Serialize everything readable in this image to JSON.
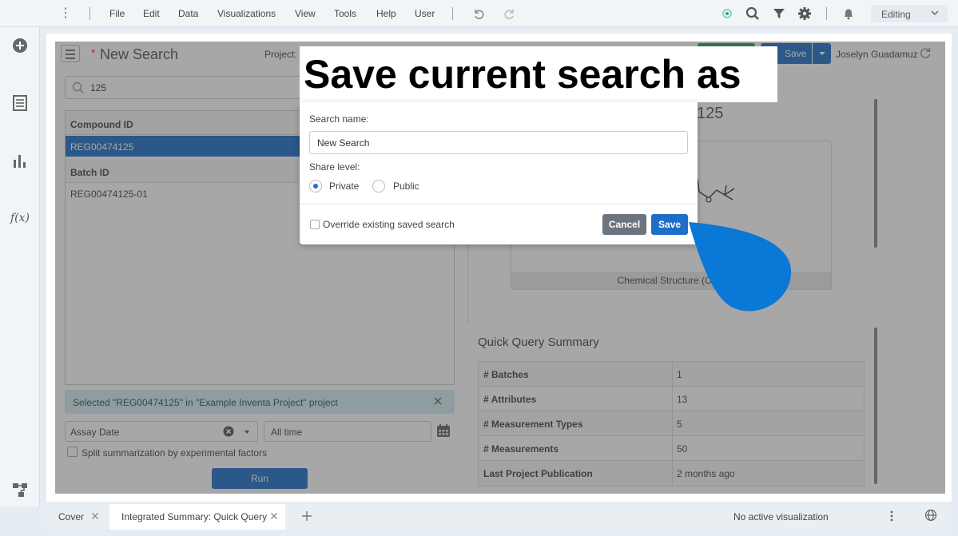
{
  "menubar": {
    "items": [
      "File",
      "Edit",
      "Data",
      "Visualizations",
      "View",
      "Tools",
      "Help",
      "User"
    ],
    "mode": "Editing"
  },
  "rail": {
    "icons": [
      "add-circle-icon",
      "data-table-icon",
      "bar-chart-icon",
      "function-icon",
      "workflow-icon"
    ],
    "fx_label": "f(x)"
  },
  "search_panel": {
    "title": "New Search",
    "required_mark": "*",
    "project_label": "Project:",
    "save_label": "Save",
    "user": "Joselyn Guadamuz",
    "query": "125",
    "table": {
      "compound_header": "Compound ID",
      "compound_rows": [
        "REG00474125"
      ],
      "batch_header": "Batch ID",
      "batch_rows": [
        "REG00474125-01"
      ]
    },
    "selected_message": "Selected  \"REG00474125\" in \"Example Inventa Project\" project",
    "assay_field": "Assay Date",
    "time_range": "All time",
    "split_label": "Split summarization by experimental factors",
    "run_label": "Run"
  },
  "detail": {
    "compound_partial": "125",
    "structure_caption": "Chemical Structure (Com",
    "summary_title": "Quick Query Summary",
    "summary_rows": [
      {
        "key": "# Batches",
        "value": "1"
      },
      {
        "key": "# Attributes",
        "value": "13"
      },
      {
        "key": "# Measurement Types",
        "value": "5"
      },
      {
        "key": "# Measurements",
        "value": "50"
      },
      {
        "key": "Last Project Publication",
        "value": "2 months ago"
      }
    ]
  },
  "dialog": {
    "title": "Save current search as",
    "name_label": "Search name:",
    "name_value": "New Search",
    "share_label": "Share level:",
    "private_label": "Private",
    "public_label": "Public",
    "share_selected": "Private",
    "override_label": "Override existing saved search",
    "cancel_label": "Cancel",
    "save_label": "Save"
  },
  "bottombar": {
    "tabs": [
      {
        "label": "Cover",
        "active": false
      },
      {
        "label": "Integrated Summary: Quick Query",
        "active": true
      }
    ],
    "status": "No active visualization"
  },
  "colors": {
    "accent": "#1e6ec8",
    "pointer": "#0a78d7",
    "cancel": "#6c757d"
  }
}
